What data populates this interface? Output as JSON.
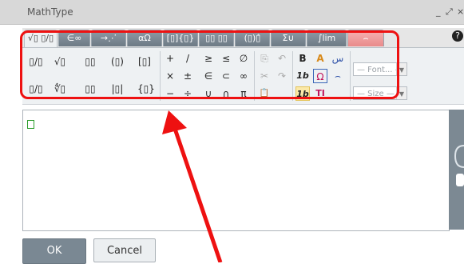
{
  "window": {
    "title": "MathType",
    "controls": [
      "_",
      "⤢",
      "×"
    ]
  },
  "tabs": [
    "√▯ ▯/▯",
    "∈∞",
    "→⋰",
    "αΩ",
    "[▯]{▯}",
    "▯▯ ▯▯",
    "(▯)▯̂",
    "Σ∪",
    "∫lim",
    "⌢"
  ],
  "help_label": "?",
  "toolbar": {
    "templates_row1": [
      "▯/▯",
      "√▯",
      "▯▯",
      "(▯)",
      "[▯]"
    ],
    "templates_row2": [
      "▯/▯",
      "∜▯",
      "▯▯",
      "|▯|",
      "{▯}"
    ],
    "symbols_row1": [
      "+",
      "/",
      "≥",
      "≤",
      "∅"
    ],
    "symbols_row2": [
      "×",
      "±",
      "∈",
      "⊂",
      "∞"
    ],
    "symbols_row3": [
      "−",
      "÷",
      "∪",
      "∩",
      "π"
    ],
    "edit_row1": [
      "⎘",
      "↶"
    ],
    "edit_row2": [
      "✂",
      "↷"
    ],
    "edit_row3": [
      "📋"
    ],
    "format_row1": [
      "B",
      "A",
      "س"
    ],
    "format_row2": [
      "1b",
      "Ω",
      "⌢"
    ],
    "format_row3": [
      "1b",
      "TI"
    ],
    "font_placeholder": "— Font... —",
    "size_placeholder": "— Size —"
  },
  "buttons": {
    "ok": "OK",
    "cancel": "Cancel"
  },
  "colors": {
    "highlight": "#ee1111",
    "arrow": "#ee1111",
    "ok_bg": "#7a8893"
  }
}
